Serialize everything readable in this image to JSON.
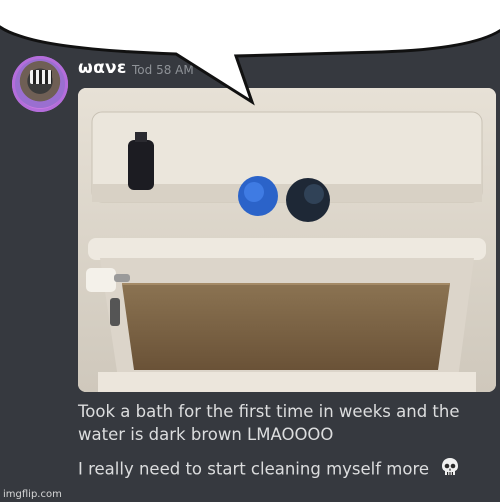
{
  "message": {
    "username": "ωανε",
    "timestamp": "Tod 58 AM",
    "text_line1": "Took a bath for the first time in weeks and the",
    "text_line2": "water is dark brown LMAOOOO",
    "text_line3": "I really need to start cleaning myself more"
  },
  "icons": {
    "avatar": "profile-avatar",
    "emoji": "skull-emoji"
  },
  "watermark": "imgflip.com",
  "colors": {
    "background": "#36393f",
    "text": "#dcddde",
    "username": "#ffffff",
    "bubble": "#ffffff",
    "water": "#7a6244"
  }
}
